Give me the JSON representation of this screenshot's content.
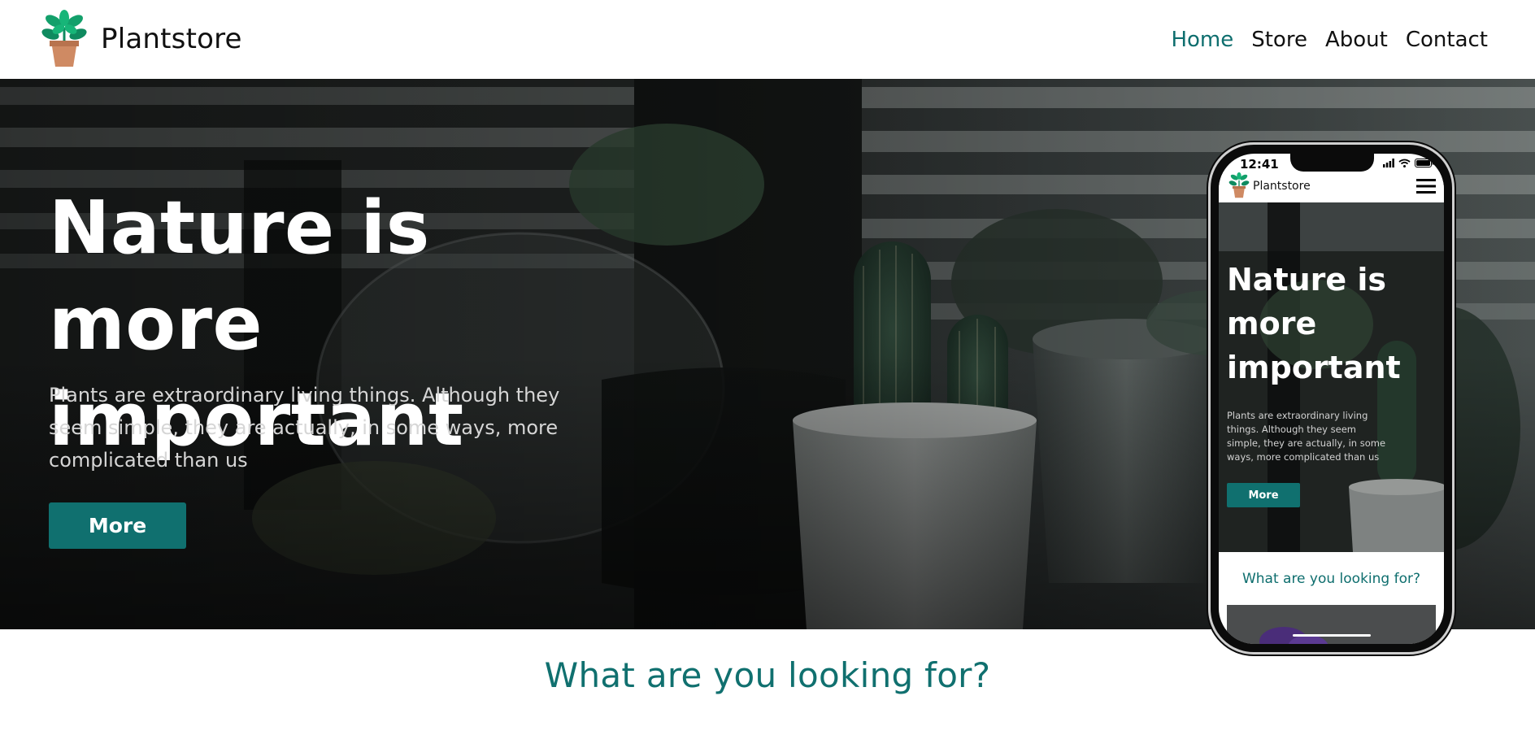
{
  "brand": {
    "name": "Plantstore",
    "logo_icon": "potted-plant-icon"
  },
  "nav": {
    "items": [
      {
        "label": "Home",
        "active": true
      },
      {
        "label": "Store",
        "active": false
      },
      {
        "label": "About",
        "active": false
      },
      {
        "label": "Contact",
        "active": false
      }
    ]
  },
  "hero": {
    "title": "Nature is more important",
    "text": "Plants are extraordinary living things. Although they seem simple, they are actually, in some ways, more complicated than us",
    "button_label": "More"
  },
  "phone": {
    "time": "12:41",
    "status_icons": [
      "signal-icon",
      "wifi-icon",
      "battery-icon"
    ],
    "brand_name": "Plantstore",
    "menu_icon": "hamburger-menu-icon",
    "hero_title": "Nature is more important",
    "hero_text": "Plants are extraordinary living things. Although they seem simple, they are actually, in some ways, more complicated than us",
    "button_label": "More",
    "section_title": "What are you looking for?"
  },
  "section": {
    "title": "What are you looking for?"
  },
  "colors": {
    "accent": "#10706f",
    "nav_active": "#0e6e6e",
    "header_bg": "#ffffff"
  }
}
